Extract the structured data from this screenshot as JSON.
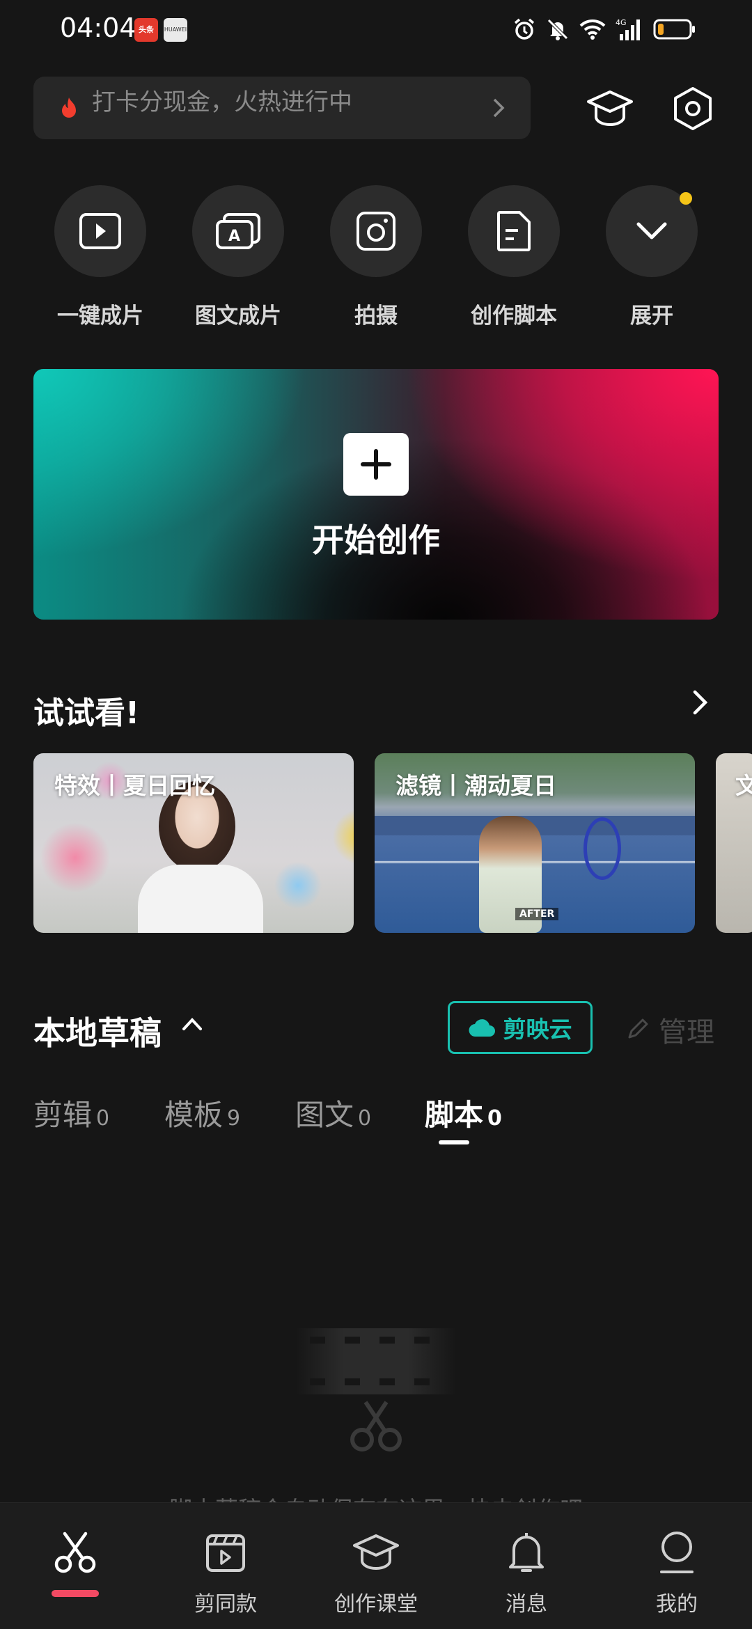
{
  "status_bar": {
    "time": "04:04",
    "notif_1": "头条",
    "notif_2": "HUAWEI",
    "network": "4G",
    "battery_level": 0.2
  },
  "search": {
    "placeholder": "打卡分现金，火热进行中"
  },
  "quick_actions": [
    {
      "label": "一键成片",
      "icon": "play-icon"
    },
    {
      "label": "图文成片",
      "icon": "text-to-video-icon"
    },
    {
      "label": "拍摄",
      "icon": "camera-icon"
    },
    {
      "label": "创作脚本",
      "icon": "script-icon"
    },
    {
      "label": "展开",
      "icon": "chevron-down-icon"
    }
  ],
  "create": {
    "label": "开始创作"
  },
  "try_section": {
    "title": "试试看!",
    "cards": [
      {
        "label": "特效丨夏日回忆"
      },
      {
        "label": "滤镜丨潮动夏日",
        "tag": "AFTER"
      },
      {
        "label": "文"
      }
    ]
  },
  "drafts": {
    "title": "本地草稿",
    "cloud_label": "剪映云",
    "manage_label": "管理",
    "tabs": [
      {
        "label": "剪辑",
        "count": "0"
      },
      {
        "label": "模板",
        "count": "9"
      },
      {
        "label": "图文",
        "count": "0"
      },
      {
        "label": "脚本",
        "count": "0",
        "active": true
      }
    ],
    "empty_text": "脚本草稿会自动保存在这里，快去创作吧"
  },
  "bottom_nav": [
    {
      "label": "",
      "icon": "scissors-icon",
      "active": true
    },
    {
      "label": "剪同款",
      "icon": "template-icon"
    },
    {
      "label": "创作课堂",
      "icon": "graduation-cap-icon"
    },
    {
      "label": "消息",
      "icon": "bell-icon"
    },
    {
      "label": "我的",
      "icon": "profile-icon"
    }
  ],
  "colors": {
    "background": "#161616",
    "accent_teal": "#19c0b0",
    "accent_red": "#f24a63",
    "notif_dot": "#f5c518"
  }
}
